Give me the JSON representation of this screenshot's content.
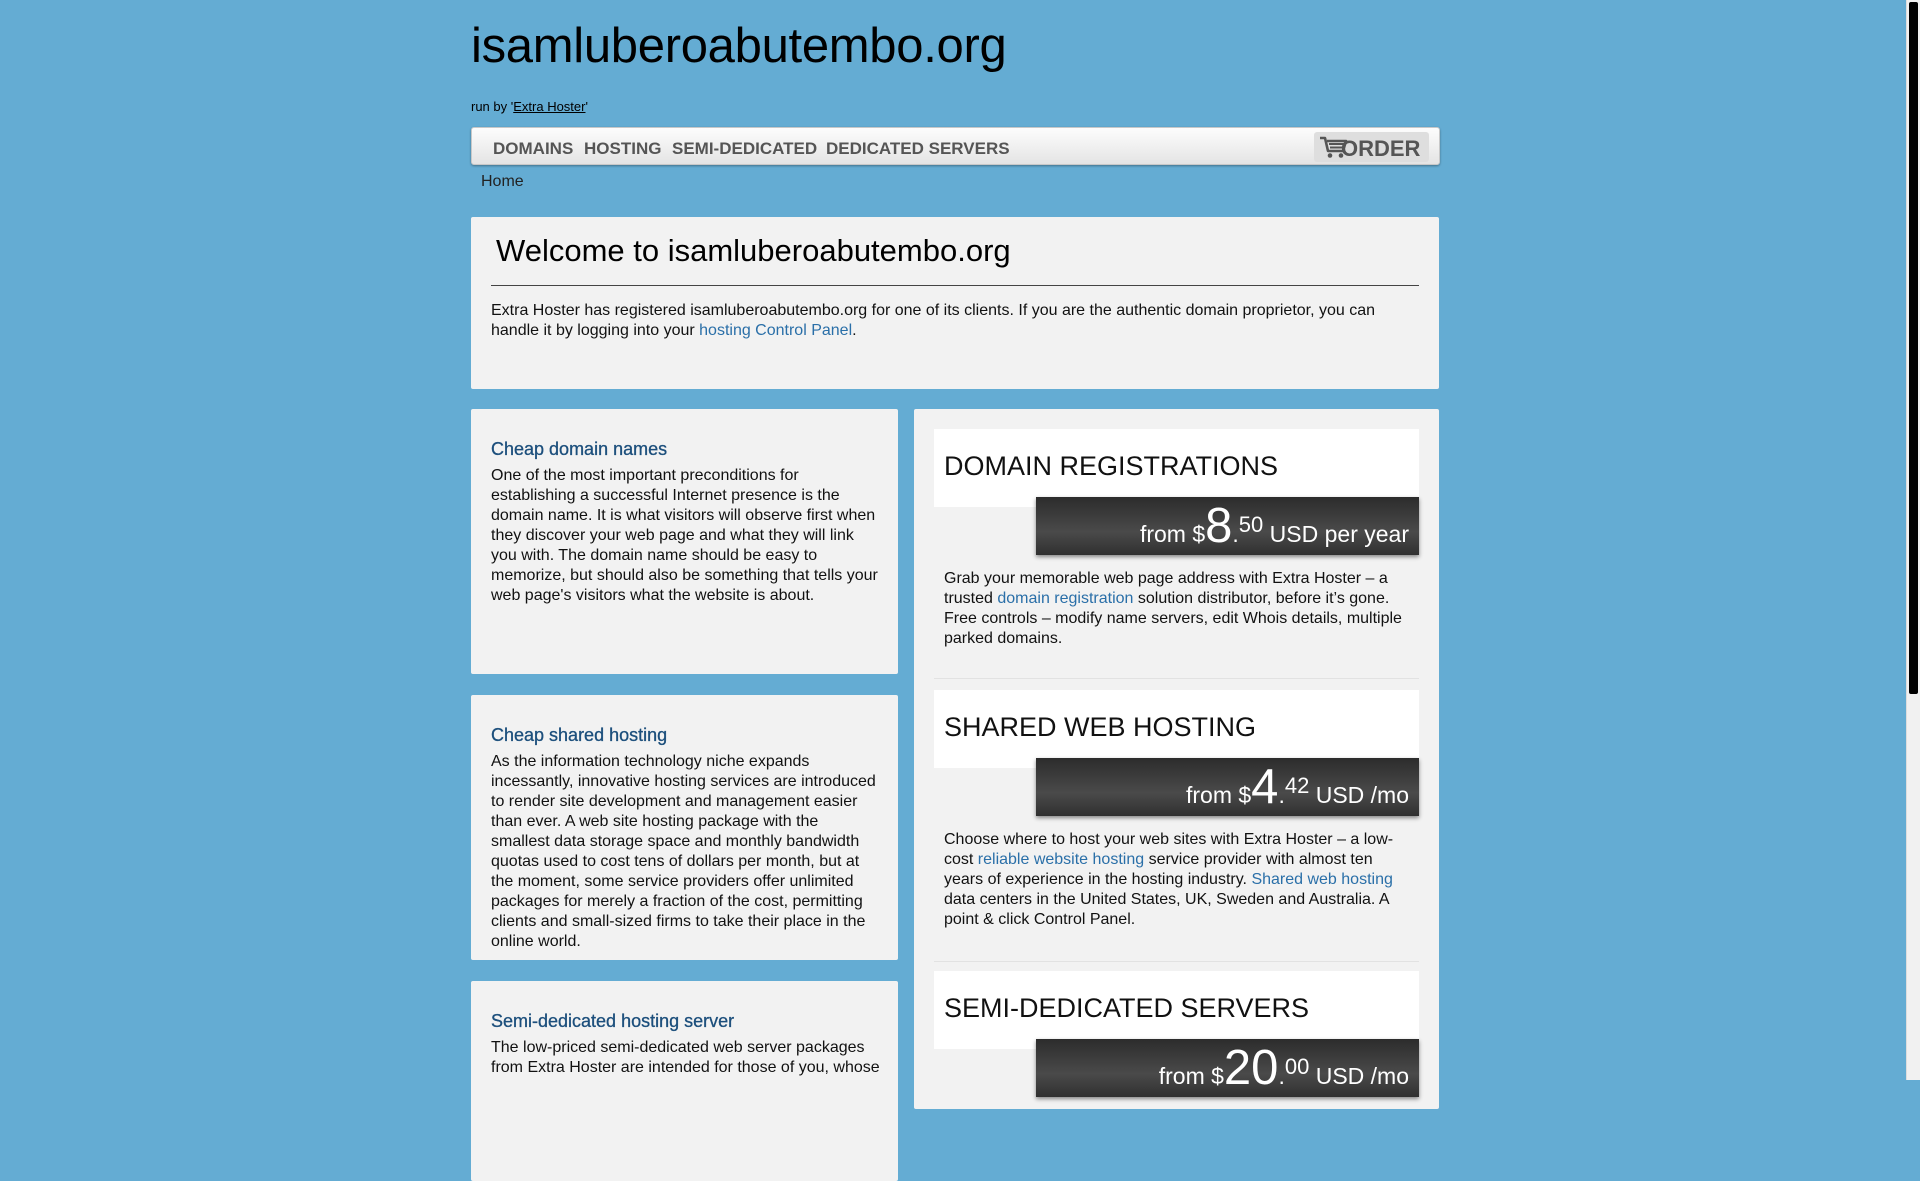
{
  "site": {
    "title": "isamluberoabutembo.org",
    "runby_prefix": "run by '",
    "runby_link": "Extra Hoster",
    "runby_suffix": "'"
  },
  "nav": {
    "items": [
      "DOMAINS",
      "HOSTING",
      "SEMI-DEDICATED",
      "DEDICATED SERVERS"
    ],
    "order_label": "ORDER",
    "order_icon": "cart-icon"
  },
  "breadcrumb": "Home",
  "welcome": {
    "title": "Welcome to isamluberoabutembo.org",
    "text_before": "Extra Hoster has registered isamluberoabutembo.org for one of its clients. If you are the authentic domain proprietor, you can handle it by logging into your ",
    "link": "hosting Control Panel",
    "text_after": "."
  },
  "left": [
    {
      "title": "Cheap domain names",
      "text": "One of the most important preconditions for establishing a successful Internet presence is the domain name. It is what visitors will observe first when they discover your web page and what they will link you with. The domain name should be easy to memorize, but should also be something that tells your web page's visitors what the website is about."
    },
    {
      "title": "Cheap shared hosting",
      "text": "As the information technology niche expands incessantly, innovative hosting services are introduced to render site development and management easier than ever. A web site hosting package with the smallest data storage space and monthly bandwidth quotas used to cost tens of dollars per month, but at the moment, some service providers offer unlimited packages for merely a fraction of the cost, permitting clients and small-sized firms to take their place in the online world."
    },
    {
      "title": "Semi-dedicated hosting server",
      "text": "The low-priced semi-dedicated web server packages from Extra Hoster are intended for those of you, whose"
    }
  ],
  "offers": [
    {
      "title": "DOMAIN REGISTRATIONS",
      "price_from": "from $",
      "price_int": "8",
      "price_dot": ".",
      "price_dec": "50",
      "price_unit": " USD per year",
      "text_a": "Grab your memorable web page address with Extra Hoster – a trusted ",
      "link_a": "domain registration",
      "text_b": " solution distributor, before it’s gone. Free controls – modify name servers, edit Whois details, multiple parked domains."
    },
    {
      "title": "SHARED WEB HOSTING",
      "price_from": "from $",
      "price_int": "4",
      "price_dot": ".",
      "price_dec": "42",
      "price_unit": " USD /mo",
      "text_a": "Choose where to host your web sites with Extra Hoster – a low-cost ",
      "link_a": "reliable website hosting",
      "text_b": " service provider with almost ten years of experience in the hosting industry. ",
      "link_b": "Shared web hosting",
      "text_c": " data centers in the United States, UK, Sweden and Australia. A point & click Control Panel."
    },
    {
      "title": "SEMI-DEDICATED SERVERS",
      "price_from": "from $",
      "price_int": "20",
      "price_dot": ".",
      "price_dec": "00",
      "price_unit": " USD /mo"
    }
  ]
}
